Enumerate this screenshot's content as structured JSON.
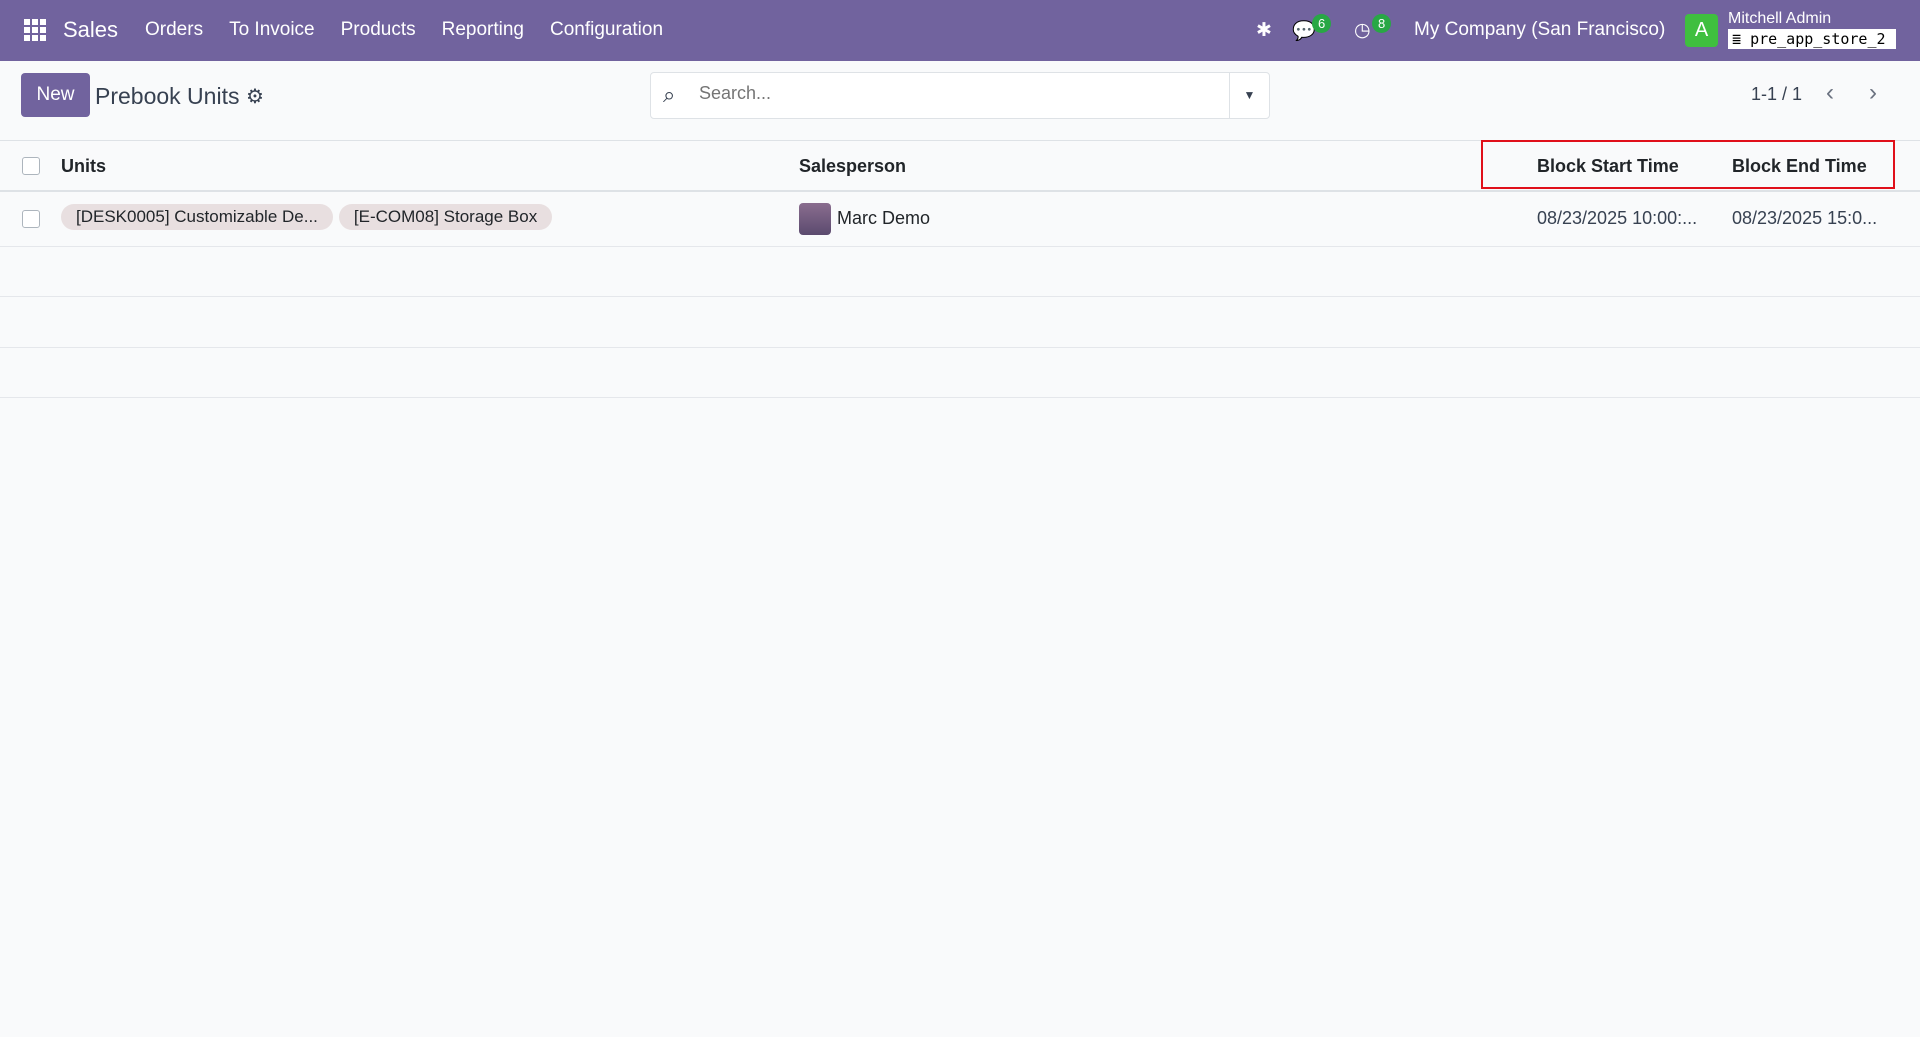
{
  "navbar": {
    "app": "Sales",
    "menu": [
      "Orders",
      "To Invoice",
      "Products",
      "Reporting",
      "Configuration"
    ],
    "messages_count": "6",
    "activities_count": "8",
    "company": "My Company (San Francisco)",
    "avatar_letter": "A",
    "user": "Mitchell Admin",
    "database": "pre_app_store_2"
  },
  "control": {
    "new_label": "New",
    "title": "Prebook Units",
    "search_placeholder": "Search...",
    "pager": "1-1 / 1"
  },
  "table": {
    "columns": [
      "Units",
      "Salesperson",
      "Block Start Time",
      "Block End Time"
    ],
    "rows": [
      {
        "units": [
          "[DESK0005] Customizable De...",
          "[E-COM08] Storage Box"
        ],
        "salesperson": "Marc Demo",
        "start": "08/23/2025 10:00:...",
        "end": "08/23/2025 15:0..."
      }
    ]
  },
  "colors": {
    "brand": "#71639e",
    "highlight": "#e0101a"
  }
}
